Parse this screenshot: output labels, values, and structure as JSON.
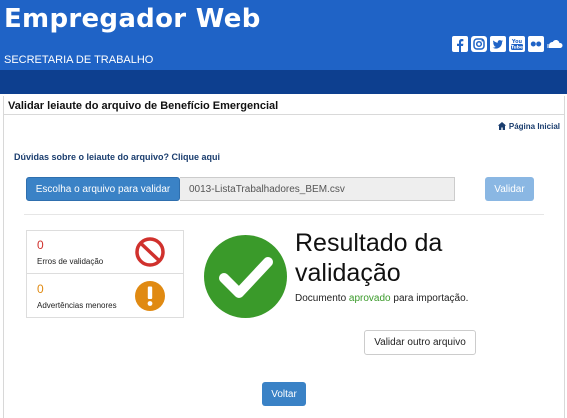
{
  "header": {
    "title": "Empregador Web",
    "subtitle": "SECRETARIA DE TRABALHO",
    "social_icons": [
      "facebook-icon",
      "instagram-icon",
      "twitter-icon",
      "youtube-icon",
      "flickr-icon",
      "soundcloud-icon"
    ]
  },
  "panel": {
    "title": "Validar leiaute do arquivo de Benefício Emergencial",
    "home_link": "Página Inicial",
    "help_link": "Dúvidas sobre o leiaute do arquivo? Clique aqui"
  },
  "upload": {
    "choose_label": "Escolha o arquivo para validar",
    "file_name": "0013-ListaTrabalhadores_BEM.csv",
    "validate_label": "Validar"
  },
  "stats": {
    "errors_count": "0",
    "errors_label": "Erros de validação",
    "warnings_count": "0",
    "warnings_label": "Advertências menores"
  },
  "result": {
    "title": "Resultado da validação",
    "msg_prefix": "Documento ",
    "msg_status": "aprovado",
    "msg_suffix": " para importação."
  },
  "actions": {
    "validate_other": "Validar outro arquivo",
    "back": "Voltar"
  },
  "colors": {
    "header_blue": "#1f63c6",
    "nav_dark_blue": "#0d3f8f",
    "primary_button": "#3a82c6",
    "error_red": "#d0312d",
    "warning_orange": "#e08a12",
    "success_green": "#3a9a2a"
  }
}
